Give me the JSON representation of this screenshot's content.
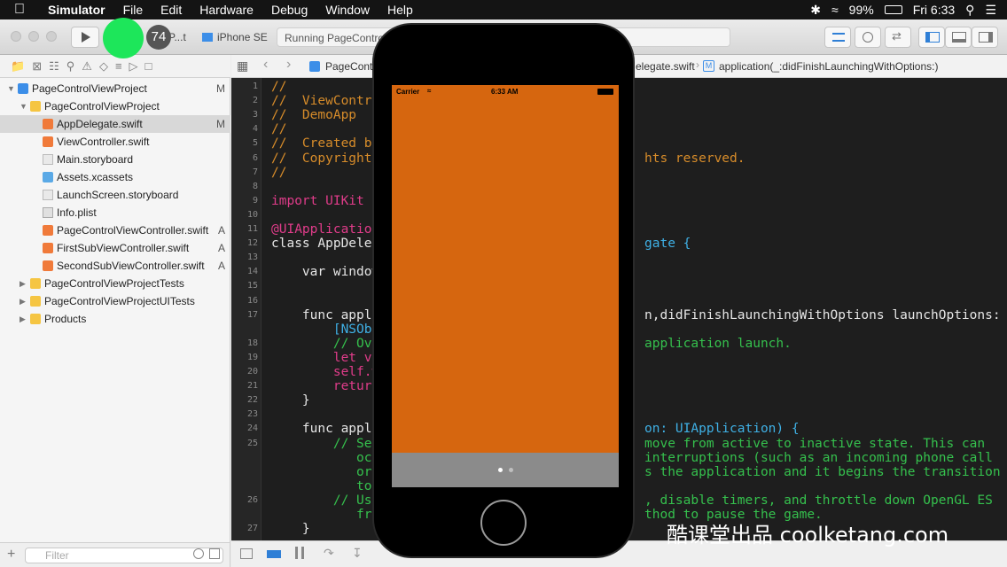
{
  "menubar": {
    "apple": "",
    "items": [
      "Simulator",
      "File",
      "Edit",
      "Hardware",
      "Debug",
      "Window",
      "Help"
    ],
    "battery": "99%",
    "time": "Fri 6:33"
  },
  "toolbar": {
    "scheme": "P...t",
    "device": "iPhone SE",
    "activity": "Running PageControl",
    "badge": "74"
  },
  "navigator": {
    "rows": [
      {
        "label": "PageControlViewProject",
        "badge": "M",
        "indent": 0,
        "icon": "project",
        "disc": "▼"
      },
      {
        "label": "PageControlViewProject",
        "badge": "",
        "indent": 1,
        "icon": "folder",
        "disc": "▼"
      },
      {
        "label": "AppDelegate.swift",
        "badge": "M",
        "indent": 2,
        "icon": "swift",
        "disc": "",
        "selected": true
      },
      {
        "label": "ViewController.swift",
        "badge": "",
        "indent": 2,
        "icon": "swift",
        "disc": ""
      },
      {
        "label": "Main.storyboard",
        "badge": "",
        "indent": 2,
        "icon": "story",
        "disc": ""
      },
      {
        "label": "Assets.xcassets",
        "badge": "",
        "indent": 2,
        "icon": "xcasset",
        "disc": ""
      },
      {
        "label": "LaunchScreen.storyboard",
        "badge": "",
        "indent": 2,
        "icon": "story",
        "disc": ""
      },
      {
        "label": "Info.plist",
        "badge": "",
        "indent": 2,
        "icon": "plist",
        "disc": ""
      },
      {
        "label": "PageControlViewController.swift",
        "badge": "A",
        "indent": 2,
        "icon": "swift",
        "disc": ""
      },
      {
        "label": "FirstSubViewController.swift",
        "badge": "A",
        "indent": 2,
        "icon": "swift",
        "disc": ""
      },
      {
        "label": "SecondSubViewController.swift",
        "badge": "A",
        "indent": 2,
        "icon": "swift",
        "disc": ""
      },
      {
        "label": "PageControlViewProjectTests",
        "badge": "",
        "indent": 1,
        "icon": "folder",
        "disc": "▶"
      },
      {
        "label": "PageControlViewProjectUITests",
        "badge": "",
        "indent": 1,
        "icon": "folder",
        "disc": "▶"
      },
      {
        "label": "Products",
        "badge": "",
        "indent": 1,
        "icon": "folder",
        "disc": "▶"
      }
    ],
    "filter_placeholder": "Filter"
  },
  "jumpbar": {
    "project": "PageCont",
    "file": "elegate.swift",
    "method": "application(_:didFinishLaunchingWithOptions:)"
  },
  "code": {
    "line_numbers": [
      "1",
      "2",
      "3",
      "4",
      "5",
      "6",
      "7",
      "8",
      "9",
      "10",
      "11",
      "12",
      "13",
      "14",
      "15",
      "16",
      "17",
      "",
      "18",
      "19",
      "20",
      "21",
      "22",
      "23",
      "24",
      "25",
      "",
      "",
      "",
      "26",
      "",
      "27"
    ],
    "lines": [
      {
        "left": "//",
        "right": "",
        "cls": "cmt",
        "rcls": "cmt"
      },
      {
        "left": "//  ViewContr",
        "right": "",
        "cls": "cmt",
        "rcls": "cmt"
      },
      {
        "left": "//  DemoApp",
        "right": "",
        "cls": "cmt",
        "rcls": "cmt"
      },
      {
        "left": "//",
        "right": "",
        "cls": "cmt",
        "rcls": "cmt"
      },
      {
        "left": "//  Created b",
        "right": "",
        "cls": "cmt",
        "rcls": "cmt"
      },
      {
        "left": "//  Copyright",
        "right": "hts reserved.",
        "cls": "cmt",
        "rcls": "cmt"
      },
      {
        "left": "//",
        "right": "",
        "cls": "cmt",
        "rcls": "cmt"
      },
      {
        "left": "",
        "right": "",
        "cls": "",
        "rcls": ""
      },
      {
        "left": "import UIKit",
        "right": "",
        "cls": "kw",
        "rcls": ""
      },
      {
        "left": "",
        "right": "",
        "cls": "",
        "rcls": ""
      },
      {
        "left": "@UIApplication",
        "right": "",
        "cls": "kw",
        "rcls": ""
      },
      {
        "left": "class AppDeleg",
        "right": "gate {",
        "cls": "",
        "rcls": "ty"
      },
      {
        "left": "",
        "right": "",
        "cls": "",
        "rcls": ""
      },
      {
        "left": "    var window",
        "right": "",
        "cls": "",
        "rcls": ""
      },
      {
        "left": "",
        "right": "",
        "cls": "",
        "rcls": ""
      },
      {
        "left": "",
        "right": "",
        "cls": "",
        "rcls": ""
      },
      {
        "left": "    func appli",
        "right": "n,didFinishLaunchingWithOptions launchOptions:",
        "cls": "",
        "rcls": ""
      },
      {
        "left": "        [NSObj",
        "right": "",
        "cls": "ty",
        "rcls": ""
      },
      {
        "left": "        // Ove",
        "right": "application launch.",
        "cls": "gr",
        "rcls": "gr"
      },
      {
        "left": "        let vc",
        "right": "",
        "cls": "kw",
        "rcls": ""
      },
      {
        "left": "        self.w",
        "right": "",
        "cls": "kw",
        "rcls": ""
      },
      {
        "left": "        return",
        "right": "",
        "cls": "kw",
        "rcls": ""
      },
      {
        "left": "    }",
        "right": "",
        "cls": "",
        "rcls": ""
      },
      {
        "left": "",
        "right": "",
        "cls": "",
        "rcls": ""
      },
      {
        "left": "    func appli",
        "right": "on: UIApplication) {",
        "cls": "",
        "rcls": "ty"
      },
      {
        "left": "        // Sen",
        "right": "move from active to inactive state. This can",
        "cls": "gr",
        "rcls": "gr"
      },
      {
        "left": "           oc",
        "right": "interruptions (such as an incoming phone call",
        "cls": "gr",
        "rcls": "gr"
      },
      {
        "left": "           or",
        "right": "s the application and it begins the transition",
        "cls": "gr",
        "rcls": "gr"
      },
      {
        "left": "           to",
        "right": "",
        "cls": "gr",
        "rcls": "gr"
      },
      {
        "left": "        // Use",
        "right": ", disable timers, and throttle down OpenGL ES",
        "cls": "gr",
        "rcls": "gr"
      },
      {
        "left": "           fr",
        "right": "thod to pause the game.",
        "cls": "gr",
        "rcls": "gr"
      },
      {
        "left": "    }",
        "right": "",
        "cls": "",
        "rcls": ""
      }
    ]
  },
  "simulator": {
    "carrier": "Carrier",
    "time": "6:33 AM",
    "background": "#d6660f",
    "pager_background": "#8b8b8b",
    "pages": 2,
    "current_page": 1
  },
  "watermark": "酷课堂出品 coolketang.com"
}
